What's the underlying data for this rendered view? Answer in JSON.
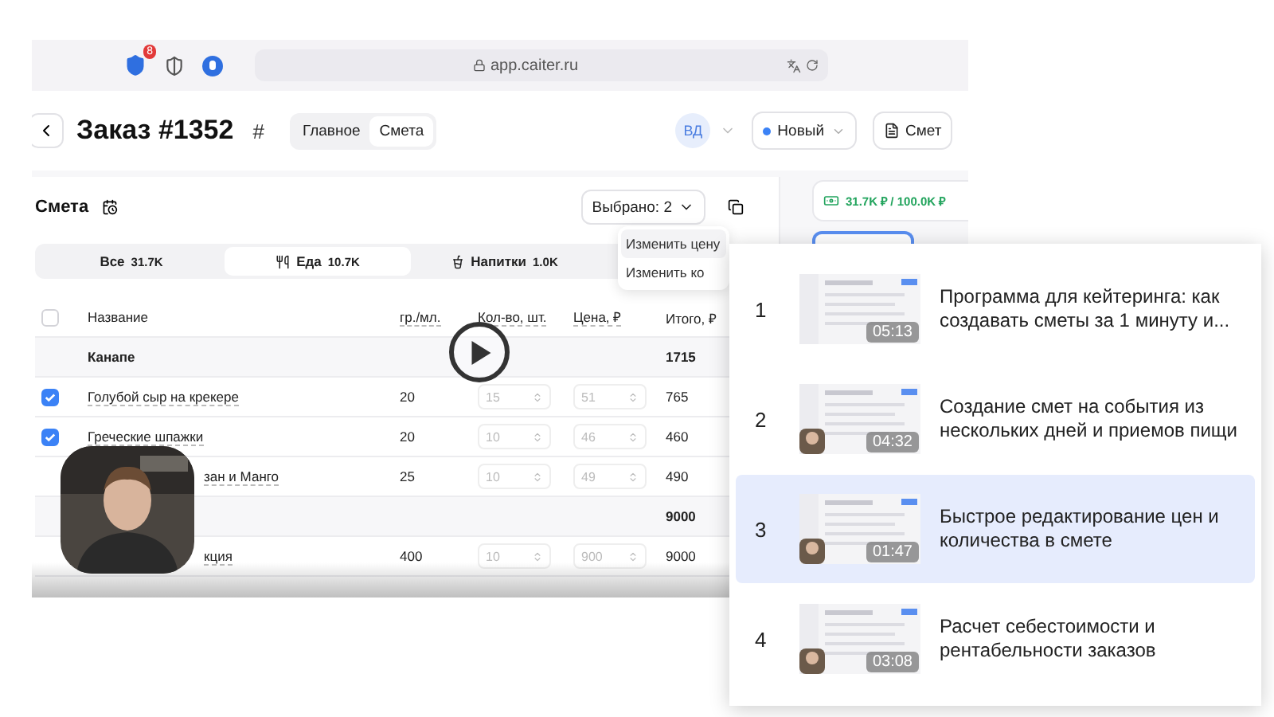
{
  "browser": {
    "address": "app.caiter.ru",
    "badge": "8"
  },
  "header": {
    "title": "Заказ #1352",
    "hash": "#",
    "tabs": [
      {
        "label": "Главное",
        "selected": false
      },
      {
        "label": "Смета",
        "selected": true
      }
    ],
    "avatar": "ВД",
    "status": "Новый",
    "doc_button": "Смет"
  },
  "budget": "31.7K ₽ / 100.0K ₽",
  "estimate": {
    "title": "Смета",
    "selection": "Выбрано: 2",
    "select_all_checked": false,
    "menu": [
      "Изменить цену",
      "Изменить ко"
    ],
    "filters": [
      {
        "label": "Все",
        "amount": "31.7K",
        "selected": false,
        "kind": "all"
      },
      {
        "label": "Еда",
        "amount": "10.7K",
        "selected": true,
        "kind": "food"
      },
      {
        "label": "Напитки",
        "amount": "1.0K",
        "selected": false,
        "kind": "drinks"
      }
    ],
    "columns": [
      "Название",
      "гр./мл.",
      "Кол-во, шт.",
      "Цена, ₽",
      "Итого, ₽"
    ],
    "rows": [
      {
        "kind": "group",
        "name": "Канапе",
        "total": "1715"
      },
      {
        "kind": "item",
        "checked": true,
        "name": "Голубой сыр на крекере",
        "weight": "20",
        "qty": "15",
        "price": "51",
        "total": "765"
      },
      {
        "kind": "item",
        "checked": true,
        "name": "Греческие шпажки",
        "weight": "20",
        "qty": "10",
        "price": "46",
        "total": "460"
      },
      {
        "kind": "obscured",
        "name": "зан и Манго",
        "weight": "25",
        "qty": "10",
        "price": "49",
        "total": "490"
      },
      {
        "kind": "obscured_group",
        "total": "9000"
      },
      {
        "kind": "obscured",
        "name": "кция",
        "weight": "400",
        "qty": "10",
        "price": "900",
        "total": "9000"
      }
    ]
  },
  "playlist": [
    {
      "number": "1",
      "title": "Программа для кейтеринга: как создавать сметы за 1 минуту и...",
      "duration": "05:13",
      "selected": false
    },
    {
      "number": "2",
      "title": "Создание смет на события из нескольких дней и приемов пищи",
      "duration": "04:32",
      "selected": false
    },
    {
      "number": "3",
      "title": "Быстрое редактирование цен и количества в смете",
      "duration": "01:47",
      "selected": true
    },
    {
      "number": "4",
      "title": "Расчет себестоимости и рентабельности заказов",
      "duration": "03:08",
      "selected": false
    }
  ]
}
